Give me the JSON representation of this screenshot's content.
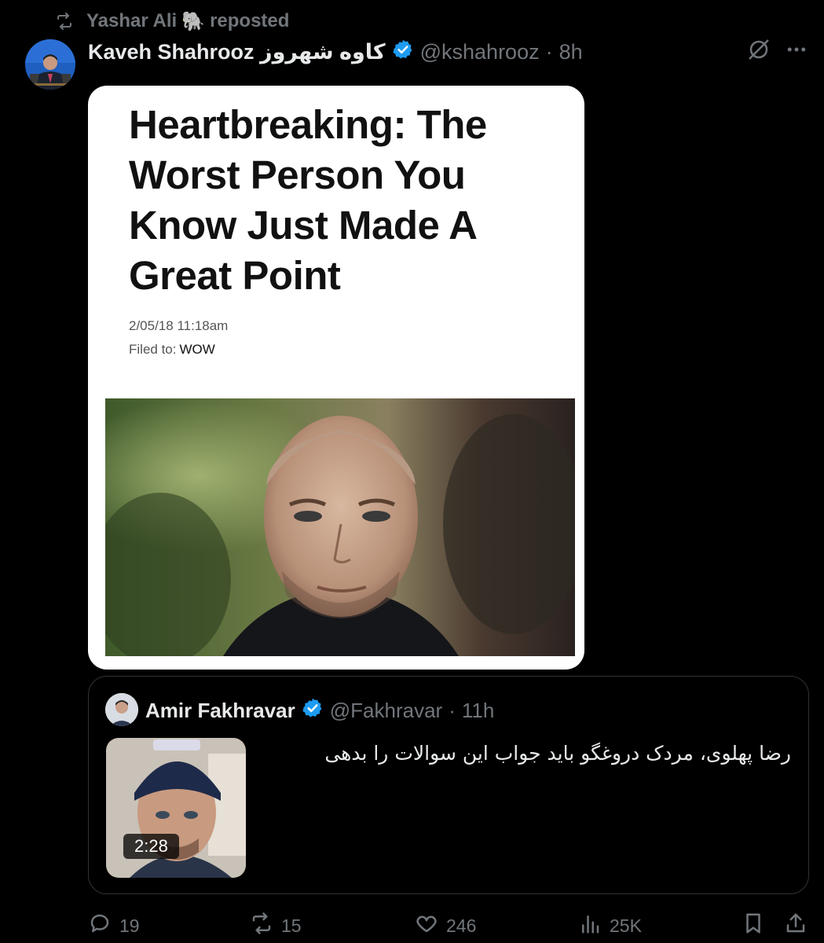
{
  "repost": {
    "user": "Yashar Ali",
    "emoji": "🐘",
    "label": "reposted"
  },
  "post": {
    "author_name": "Kaveh Shahrooz کاوه شهروز",
    "handle": "@kshahrooz",
    "separator": "·",
    "time": "8h"
  },
  "article": {
    "headline": "Heartbreaking: The Worst Person You Know Just Made A Great Point",
    "date": "2/05/18 11:18am",
    "filed_label": "Filed to:",
    "filed_value": "WOW"
  },
  "quote": {
    "author_name": "Amir Fakhravar",
    "handle": "@Fakhravar",
    "separator": "·",
    "time": "11h",
    "text": "رضا پهلوی، مردک دروغگو باید جواب این سوالات را بدهی",
    "video_duration": "2:28"
  },
  "actions": {
    "replies": "19",
    "reposts": "15",
    "likes": "246",
    "views": "25K"
  },
  "colors": {
    "background": "#000000",
    "muted": "#71767b",
    "verified": "#1d9bf0",
    "border": "#2f3336"
  }
}
